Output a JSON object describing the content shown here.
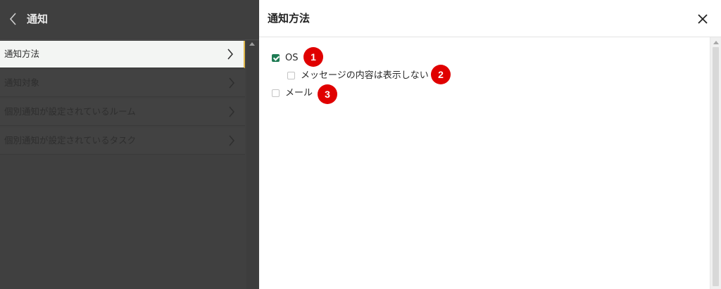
{
  "left_panel": {
    "title": "通知",
    "items": [
      {
        "label": "通知方法",
        "active": true
      },
      {
        "label": "通知対象",
        "active": false
      },
      {
        "label": "個別通知が設定されているルーム",
        "active": false
      },
      {
        "label": "個別通知が設定されているタスク",
        "active": false
      }
    ]
  },
  "dialog": {
    "title": "通知方法",
    "options": [
      {
        "label": "OS",
        "checked": true,
        "badge": "1"
      },
      {
        "label": "メッセージの内容は表示しない",
        "checked": false,
        "badge": "2"
      },
      {
        "label": "メール",
        "checked": false,
        "badge": "3"
      }
    ]
  },
  "colors": {
    "accent_green": "#1e7b54",
    "annotation_red": "#e00000",
    "active_border": "#e0b84a",
    "overlay_dark": "#404040"
  },
  "icons": [
    "chevron-left-icon",
    "chevron-right-icon",
    "close-icon"
  ]
}
